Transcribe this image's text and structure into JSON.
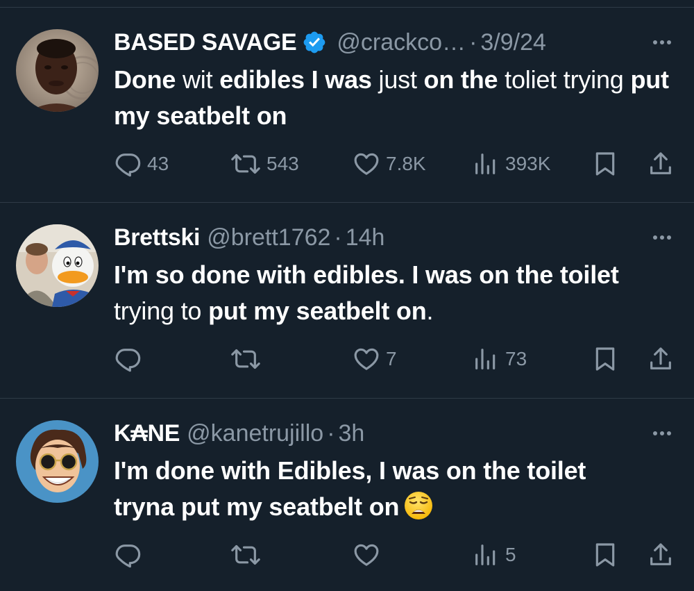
{
  "colors": {
    "background": "#15202b",
    "divider": "#2f3b47",
    "text_primary": "#ffffff",
    "text_secondary": "#8b98a5",
    "verified_blue": "#1d9bf0"
  },
  "tweets": [
    {
      "display_name": "BASED SAVAGE",
      "verified": true,
      "handle": "@crackco…",
      "separator": "·",
      "time": "3/9/24",
      "text_segments": [
        {
          "t": "Done",
          "bold": true
        },
        {
          "t": " wit ",
          "bold": false
        },
        {
          "t": "edibles I was",
          "bold": true
        },
        {
          "t": " just ",
          "bold": false
        },
        {
          "t": "on the",
          "bold": true
        },
        {
          "t": " toliet trying ",
          "bold": false
        },
        {
          "t": "put my seatbelt on",
          "bold": true
        }
      ],
      "replies": "43",
      "retweets": "543",
      "likes": "7.8K",
      "views": "393K"
    },
    {
      "display_name": "Brettski",
      "verified": false,
      "handle": "@brett1762",
      "separator": "·",
      "time": "14h",
      "text_segments": [
        {
          "t": "I'm so done with edibles. I was on the toilet",
          "bold": true
        },
        {
          "t": " trying to ",
          "bold": false
        },
        {
          "t": "put my seatbelt on",
          "bold": true
        },
        {
          "t": ".",
          "bold": false
        }
      ],
      "replies": "",
      "retweets": "",
      "likes": "7",
      "views": "73"
    },
    {
      "display_name": "K₳NE",
      "verified": false,
      "handle": "@kanetrujillo",
      "separator": "·",
      "time": "3h",
      "text_segments": [
        {
          "t": "I'm done with Edibles, I was on the toilet tryna put my seatbelt on",
          "bold": true
        }
      ],
      "emoji": "weary-face-emoji",
      "replies": "",
      "retweets": "",
      "likes": "",
      "views": "5"
    }
  ],
  "icons": {
    "reply": "reply-icon",
    "retweet": "retweet-icon",
    "like": "heart-icon",
    "views": "views-icon",
    "bookmark": "bookmark-icon",
    "share": "share-icon",
    "more": "more-dots-icon",
    "verified": "verified-badge-icon"
  }
}
